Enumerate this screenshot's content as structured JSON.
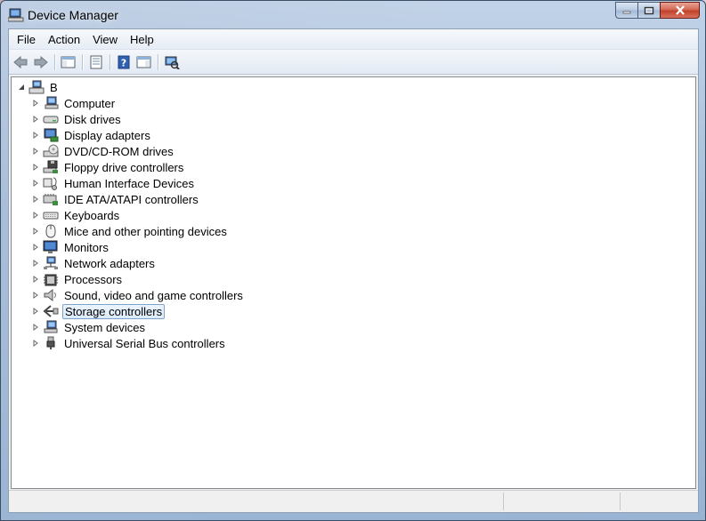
{
  "window": {
    "title": "Device Manager"
  },
  "menu": [
    "File",
    "Action",
    "View",
    "Help"
  ],
  "toolbar": {
    "buttons": [
      "back-icon",
      "forward-icon",
      "show-hide-console-tree-icon",
      "properties-icon",
      "help-icon",
      "show-action-pane-icon",
      "scan-hardware-changes-icon"
    ]
  },
  "tree": {
    "root": "B",
    "items": [
      {
        "label": "Computer",
        "icon": "computer-icon"
      },
      {
        "label": "Disk drives",
        "icon": "disk-drive-icon"
      },
      {
        "label": "Display adapters",
        "icon": "display-adapter-icon"
      },
      {
        "label": "DVD/CD-ROM drives",
        "icon": "dvd-drive-icon"
      },
      {
        "label": "Floppy drive controllers",
        "icon": "floppy-controller-icon"
      },
      {
        "label": "Human Interface Devices",
        "icon": "hid-icon"
      },
      {
        "label": "IDE ATA/ATAPI controllers",
        "icon": "ide-controller-icon"
      },
      {
        "label": "Keyboards",
        "icon": "keyboard-icon"
      },
      {
        "label": "Mice and other pointing devices",
        "icon": "mouse-icon"
      },
      {
        "label": "Monitors",
        "icon": "monitor-icon"
      },
      {
        "label": "Network adapters",
        "icon": "network-adapter-icon"
      },
      {
        "label": "Processors",
        "icon": "processor-icon"
      },
      {
        "label": "Sound, video and game controllers",
        "icon": "sound-icon"
      },
      {
        "label": "Storage controllers",
        "icon": "storage-controller-icon",
        "selected": true
      },
      {
        "label": "System devices",
        "icon": "system-devices-icon"
      },
      {
        "label": "Universal Serial Bus controllers",
        "icon": "usb-icon"
      }
    ]
  },
  "colors": {
    "selection_border": "#7da2ce",
    "selection_fill": "#dcebfc",
    "close_button": "#c1412b"
  }
}
